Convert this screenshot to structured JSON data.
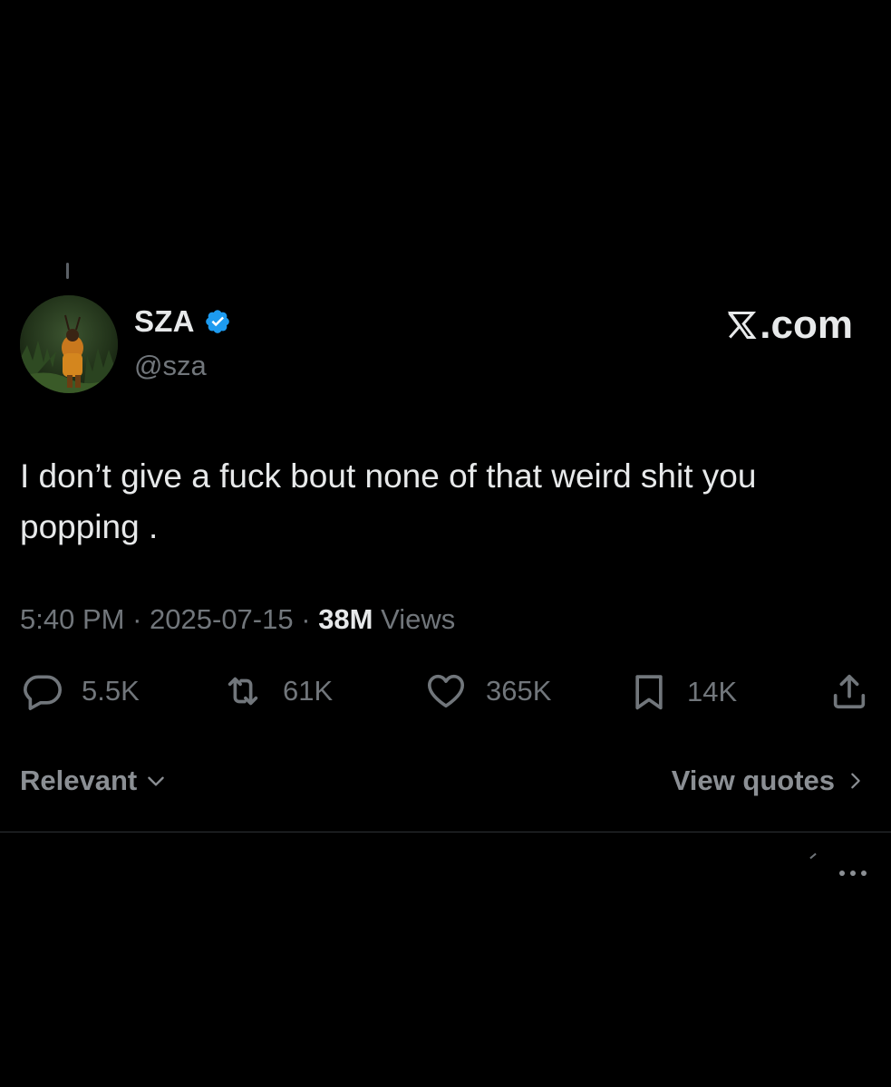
{
  "author": {
    "display_name": "SZA",
    "handle": "@sza",
    "verified": true,
    "verified_color": "#1d9bf0",
    "avatar_icon": "profile-photo"
  },
  "brand": {
    "label": ".com"
  },
  "tweet": {
    "text": "I don’t give a fuck bout none of that weird shit you\npopping .",
    "time": "5:40 PM",
    "separator": "·",
    "date": "2025-07-15",
    "views_count": "38M",
    "views_label": "Views"
  },
  "actions": {
    "replies": "5.5K",
    "reposts": "61K",
    "likes": "365K",
    "bookmarks": "14K"
  },
  "replies_section": {
    "sort_label": "Relevant",
    "view_quotes_label": "View quotes"
  },
  "colors": {
    "background": "#000000",
    "primary_text": "#e7e9ea",
    "secondary_text": "#71767b",
    "divider": "#2f3336"
  }
}
